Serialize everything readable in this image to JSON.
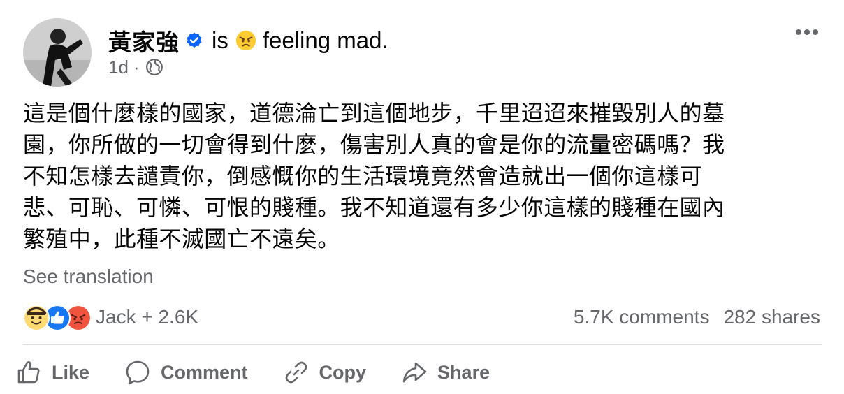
{
  "author": {
    "name": "黃家強",
    "is_word": "is",
    "feeling": "feeling mad.",
    "verified_icon": "verified-badge-icon",
    "feeling_icon": "angry-face-icon",
    "avatar_icon": "profile-photo"
  },
  "meta": {
    "time": "1d",
    "separator": "·",
    "audience_icon": "globe-icon"
  },
  "more_icon": "more-options-icon",
  "post": {
    "text": "這是個什麼樣的國家，道德淪亡到這個地步，千里迢迢來摧毀別人的墓\n園，你所做的一切會得到什麼，傷害別人真的會是你的流量密碼嗎？我\n不知怎樣去譴責你，倒感慨你的生活環境竟然會造就出一個你這樣可\n悲、可恥、可憐、可恨的賤種。我不知道還有多少你這樣的賤種在國內\n繁殖中，此種不滅國亡不遠矣。"
  },
  "see_translation": "See translation",
  "reactions": {
    "icons": [
      "care-face-icon",
      "like-icon",
      "angry-icon"
    ],
    "summary": "Jack + 2.6K"
  },
  "stats": {
    "comments": "5.7K comments",
    "shares": "282 shares"
  },
  "actions": {
    "like": "Like",
    "comment": "Comment",
    "copy": "Copy",
    "share": "Share"
  },
  "colors": {
    "text": "#050505",
    "secondary": "#65676b",
    "verified_blue": "#0866ff",
    "like_blue": "#1877f2",
    "angry_red": "#f0533e",
    "divider": "#dcdee2"
  }
}
